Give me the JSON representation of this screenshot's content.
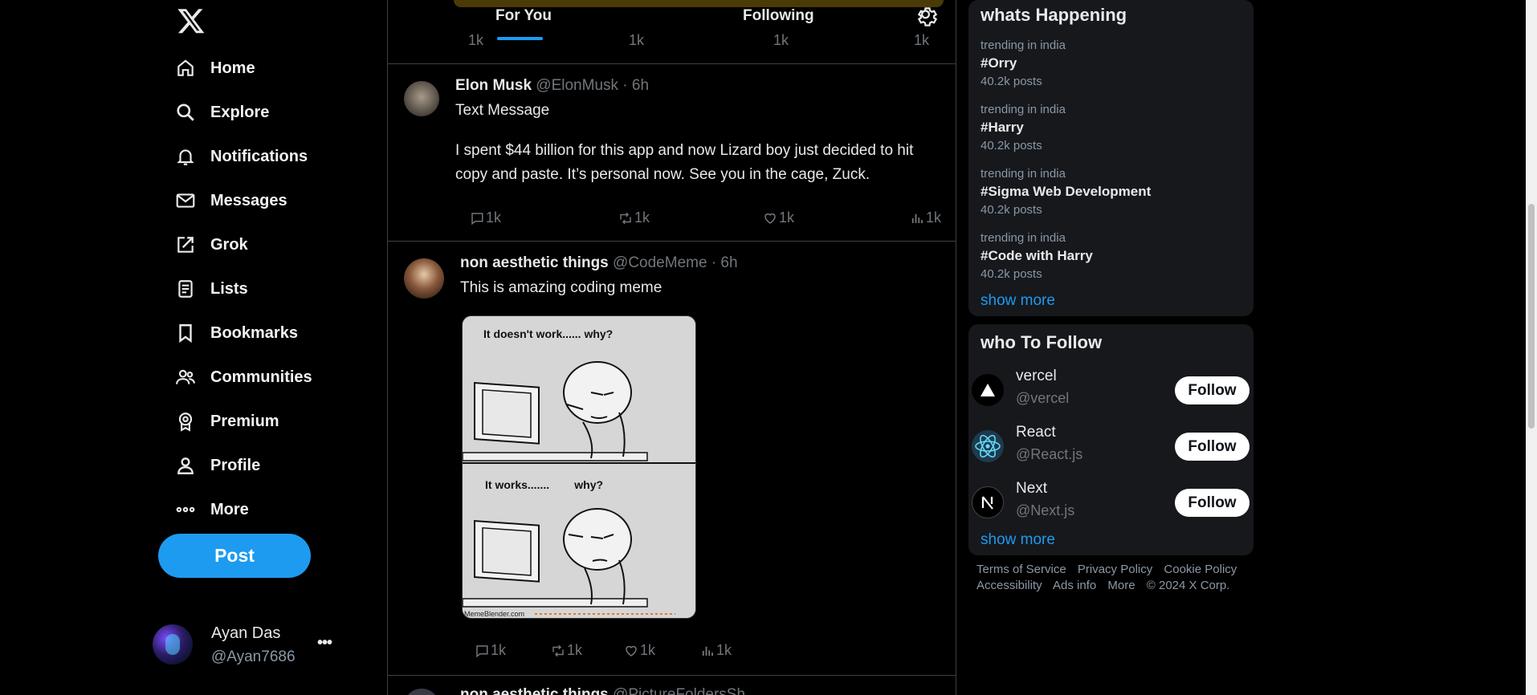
{
  "nav": {
    "items": [
      {
        "label": "Home",
        "icon": "home-icon"
      },
      {
        "label": "Explore",
        "icon": "search-icon"
      },
      {
        "label": "Notifications",
        "icon": "bell-icon"
      },
      {
        "label": "Messages",
        "icon": "mail-icon"
      },
      {
        "label": "Grok",
        "icon": "grok-icon"
      },
      {
        "label": "Lists",
        "icon": "list-icon"
      },
      {
        "label": "Bookmarks",
        "icon": "bookmark-icon"
      },
      {
        "label": "Communities",
        "icon": "people-icon"
      },
      {
        "label": "Premium",
        "icon": "premium-icon"
      },
      {
        "label": "Profile",
        "icon": "person-icon"
      },
      {
        "label": "More",
        "icon": "more-icon"
      }
    ],
    "post_label": "Post"
  },
  "account": {
    "name": "Ayan Das",
    "handle": "@Ayan7686"
  },
  "feed": {
    "tabs": [
      "For You",
      "Following"
    ],
    "faded_counts": [
      "1k",
      "1k",
      "1k",
      "1k"
    ],
    "tweets": [
      {
        "name": "Elon Musk",
        "meta": "@ElonMusk · 6h",
        "title": "Text Message",
        "body": "I spent $44 billion for this app and now Lizard boy just decided to hit copy and paste. It’s personal now. See you in the cage, Zuck.",
        "replies": "1k",
        "retweets": "1k",
        "likes": "1k",
        "views": "1k"
      },
      {
        "name": "non aesthetic things",
        "meta": "@CodeMeme · 6h",
        "title": "This is amazing coding meme",
        "meme_top": "It doesn't work...... why?",
        "meme_bottom": "It works.......        why?",
        "meme_credit": "MemeBlender.com",
        "replies": "1k",
        "retweets": "1k",
        "likes": "1k",
        "views": "1k"
      }
    ],
    "partial_tweet": {
      "name": "non aesthetic things",
      "meta": "@PictureFoldersSh"
    }
  },
  "trends": {
    "title": "whats Happening",
    "items": [
      {
        "context": "trending in india",
        "tag": "#Orry",
        "count": "40.2k posts"
      },
      {
        "context": "trending in india",
        "tag": "#Harry",
        "count": "40.2k posts"
      },
      {
        "context": "trending in india",
        "tag": "#Sigma Web Development",
        "count": "40.2k posts"
      },
      {
        "context": "trending in india",
        "tag": "#Code with Harry",
        "count": "40.2k posts"
      }
    ],
    "show_more": "show more"
  },
  "who_to_follow": {
    "title": "who To Follow",
    "items": [
      {
        "name": "vercel",
        "handle": "@vercel",
        "button": "Follow"
      },
      {
        "name": "React",
        "handle": "@React.js",
        "button": "Follow"
      },
      {
        "name": "Next",
        "handle": "@Next.js",
        "button": "Follow"
      }
    ],
    "show_more": "show more"
  },
  "footer": {
    "links": [
      "Terms of Service",
      "Privacy Policy",
      "Cookie Policy",
      "Accessibility",
      "Ads info",
      "More",
      "© 2024 X Corp."
    ]
  },
  "colors": {
    "accent": "#1d9bf0",
    "background": "#000000",
    "card": "#16181c",
    "muted": "#71767b"
  }
}
